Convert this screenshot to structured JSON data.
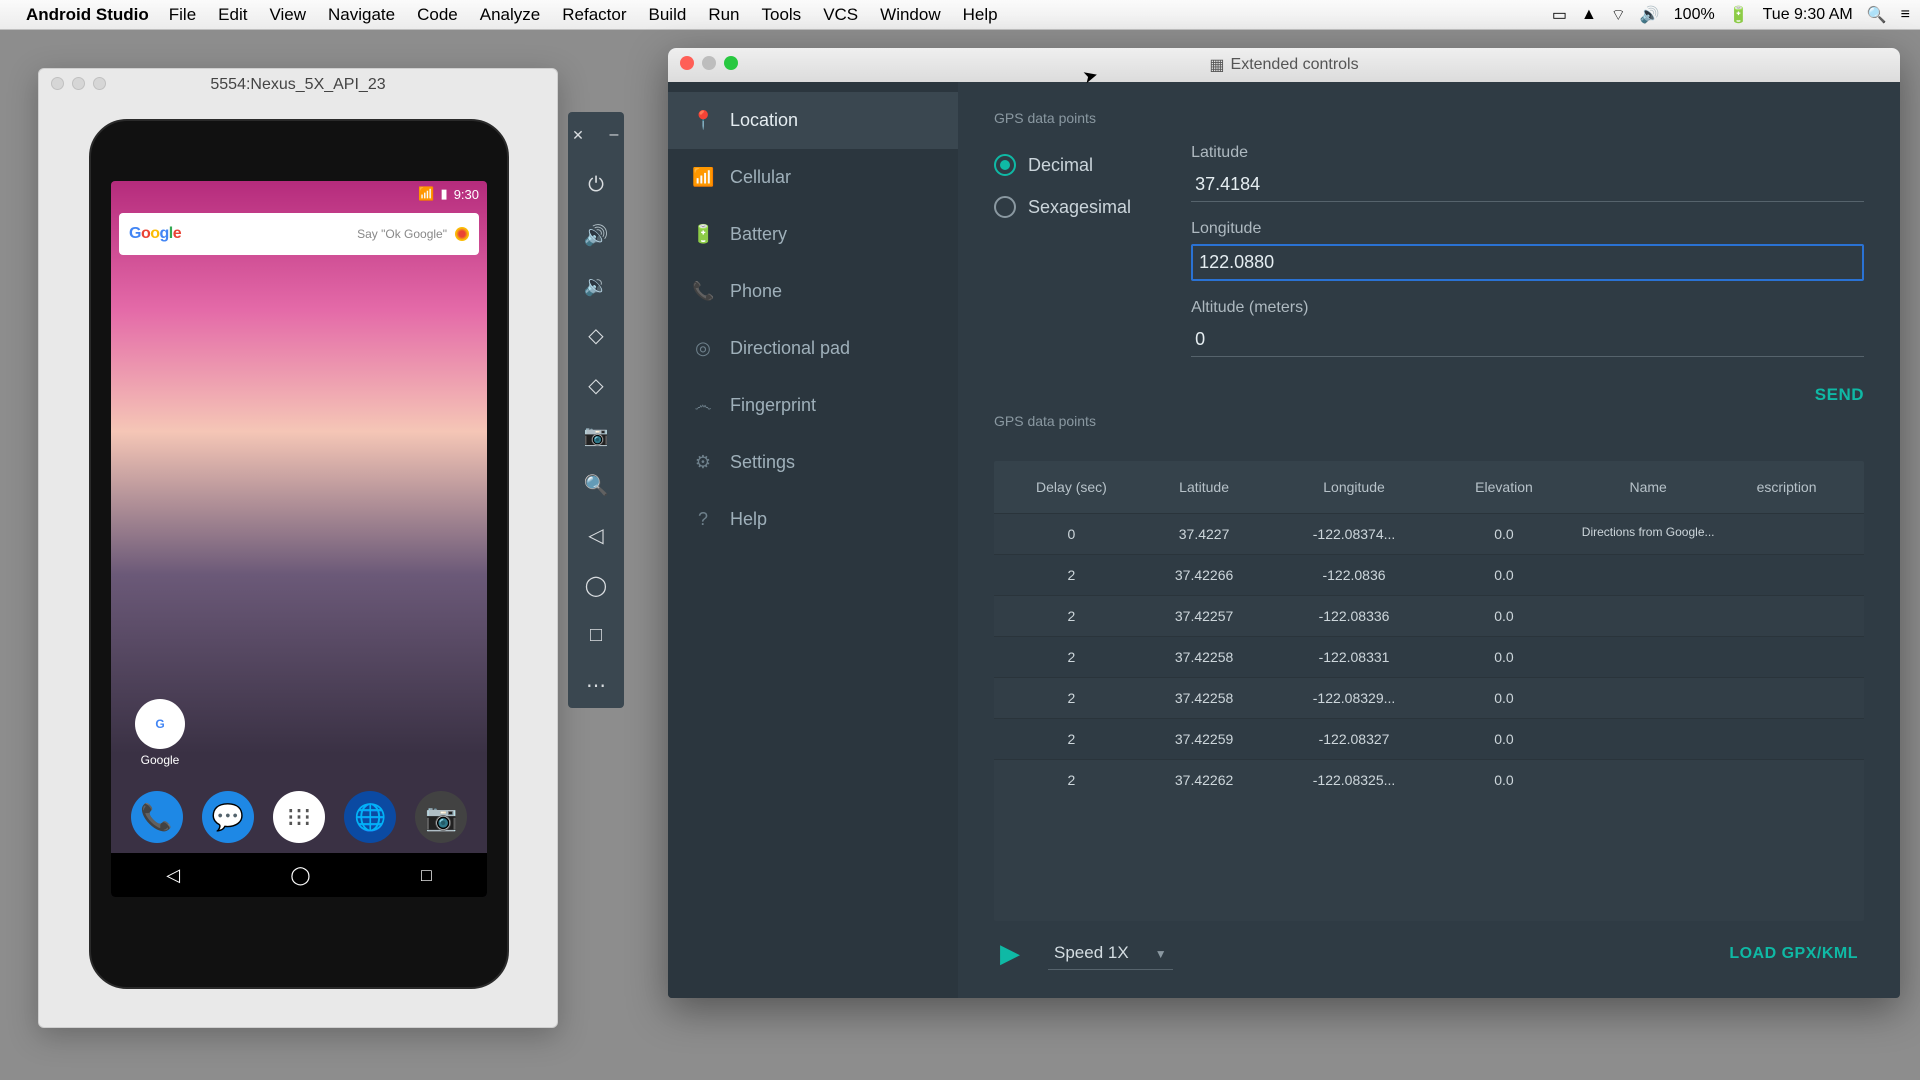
{
  "menubar": {
    "app_name": "Android Studio",
    "items": [
      "File",
      "Edit",
      "View",
      "Navigate",
      "Code",
      "Analyze",
      "Refactor",
      "Build",
      "Run",
      "Tools",
      "VCS",
      "Window",
      "Help"
    ],
    "battery": "100%",
    "clock": "Tue 9:30 AM"
  },
  "emulator_window": {
    "title": "5554:Nexus_5X_API_23",
    "phone": {
      "status_time": "9:30",
      "search_hint": "Say \"Ok Google\"",
      "google_label": "Google"
    }
  },
  "side_toolbar": {
    "items": [
      "close",
      "minimize",
      "power",
      "volume-up",
      "volume-down",
      "rotate-left",
      "rotate-right",
      "camera",
      "zoom",
      "back",
      "home",
      "overview",
      "more"
    ]
  },
  "extended_controls": {
    "title": "Extended controls",
    "nav": [
      {
        "icon": "📍",
        "label": "Location",
        "selected": true
      },
      {
        "icon": "📶",
        "label": "Cellular"
      },
      {
        "icon": "🔋",
        "label": "Battery"
      },
      {
        "icon": "📞",
        "label": "Phone"
      },
      {
        "icon": "◎",
        "label": "Directional pad"
      },
      {
        "icon": "෴",
        "label": "Fingerprint"
      },
      {
        "icon": "⚙",
        "label": "Settings"
      },
      {
        "icon": "?",
        "label": "Help"
      }
    ],
    "section1_label": "GPS data points",
    "coord_format": {
      "decimal": "Decimal",
      "sexagesimal": "Sexagesimal",
      "selected": "decimal"
    },
    "fields": {
      "latitude_label": "Latitude",
      "latitude_value": "37.4184",
      "longitude_label": "Longitude",
      "longitude_value": "122.0880",
      "altitude_label": "Altitude (meters)",
      "altitude_value": "0"
    },
    "send_label": "SEND",
    "section2_label": "GPS data points",
    "table": {
      "headers": [
        "Delay (sec)",
        "Latitude",
        "Longitude",
        "Elevation",
        "Name",
        "escription"
      ],
      "rows": [
        {
          "delay": "0",
          "lat": "37.4227",
          "lon": "-122.08374...",
          "elev": "0.0",
          "name": "Directions from Google...",
          "desc": ""
        },
        {
          "delay": "2",
          "lat": "37.42266",
          "lon": "-122.0836",
          "elev": "0.0",
          "name": "",
          "desc": ""
        },
        {
          "delay": "2",
          "lat": "37.42257",
          "lon": "-122.08336",
          "elev": "0.0",
          "name": "",
          "desc": ""
        },
        {
          "delay": "2",
          "lat": "37.42258",
          "lon": "-122.08331",
          "elev": "0.0",
          "name": "",
          "desc": ""
        },
        {
          "delay": "2",
          "lat": "37.42258",
          "lon": "-122.08329...",
          "elev": "0.0",
          "name": "",
          "desc": ""
        },
        {
          "delay": "2",
          "lat": "37.42259",
          "lon": "-122.08327",
          "elev": "0.0",
          "name": "",
          "desc": ""
        },
        {
          "delay": "2",
          "lat": "37.42262",
          "lon": "-122.08325...",
          "elev": "0.0",
          "name": "",
          "desc": ""
        }
      ]
    },
    "speed_label": "Speed 1X",
    "load_label": "LOAD GPX/KML"
  }
}
